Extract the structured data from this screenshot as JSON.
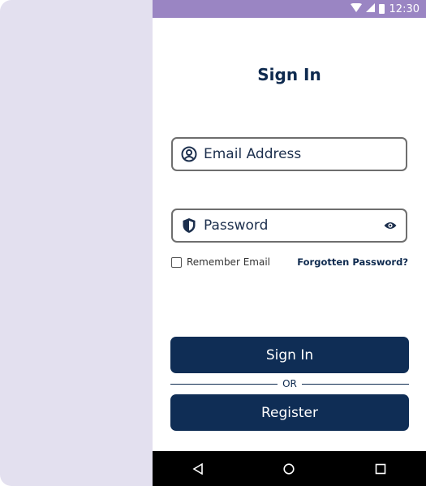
{
  "status_bar": {
    "time": "12:30",
    "icons": [
      "wifi-icon",
      "signal-icon",
      "battery-icon"
    ]
  },
  "title": "Sign In",
  "email_field": {
    "placeholder": "Email Address",
    "icon": "user-circle-icon"
  },
  "password_field": {
    "placeholder": "Password",
    "icon": "shield-icon",
    "toggle_icon": "eye-icon"
  },
  "remember": {
    "label": "Remember Email",
    "checked": false
  },
  "forgot_link": "Forgotten Password?",
  "buttons": {
    "sign_in": "Sign In",
    "or": "OR",
    "register": "Register"
  },
  "nav_bar": {
    "icons": [
      "back-icon",
      "home-icon",
      "recents-icon"
    ]
  },
  "colors": {
    "primary": "#0f2d55",
    "status_bar": "#9a85c3",
    "side_panel": "#e3e0ef",
    "text": "#0e2a4f"
  }
}
